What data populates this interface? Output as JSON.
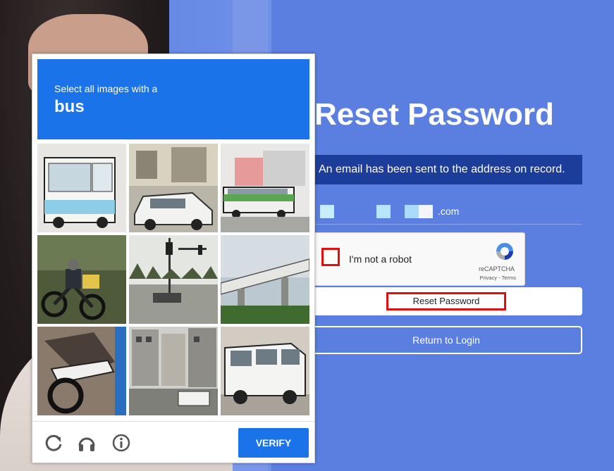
{
  "page": {
    "title": "Reset Password",
    "notice": "An email has been sent to the address on record.",
    "email_domain": ".com"
  },
  "recaptcha": {
    "checkbox_label": "I'm not a robot",
    "brand": "reCAPTCHA",
    "links": "Privacy - Terms"
  },
  "buttons": {
    "reset": "Reset Password",
    "return_login": "Return to Login"
  },
  "challenge": {
    "instruction": "Select all images with a",
    "target": "bus",
    "verify": "VERIFY",
    "tiles": [
      {
        "name": "tile-bus-front",
        "scene": "bus"
      },
      {
        "name": "tile-street-car",
        "scene": "car"
      },
      {
        "name": "tile-bus-side",
        "scene": "bus"
      },
      {
        "name": "tile-motorcycle-rider",
        "scene": "motorcycle"
      },
      {
        "name": "tile-traffic-lights",
        "scene": "street"
      },
      {
        "name": "tile-bridge",
        "scene": "bridge"
      },
      {
        "name": "tile-motorcycle-closeup",
        "scene": "motorcycle"
      },
      {
        "name": "tile-city-street",
        "scene": "street"
      },
      {
        "name": "tile-minibus",
        "scene": "bus"
      }
    ]
  },
  "colors": {
    "accent": "#1a73e8",
    "background": "#5b7fe0",
    "highlight": "#e01010",
    "notice_bg": "#1d3d9a"
  },
  "icons": {
    "reload": "reload-icon",
    "audio": "headphones-icon",
    "info": "info-icon"
  }
}
